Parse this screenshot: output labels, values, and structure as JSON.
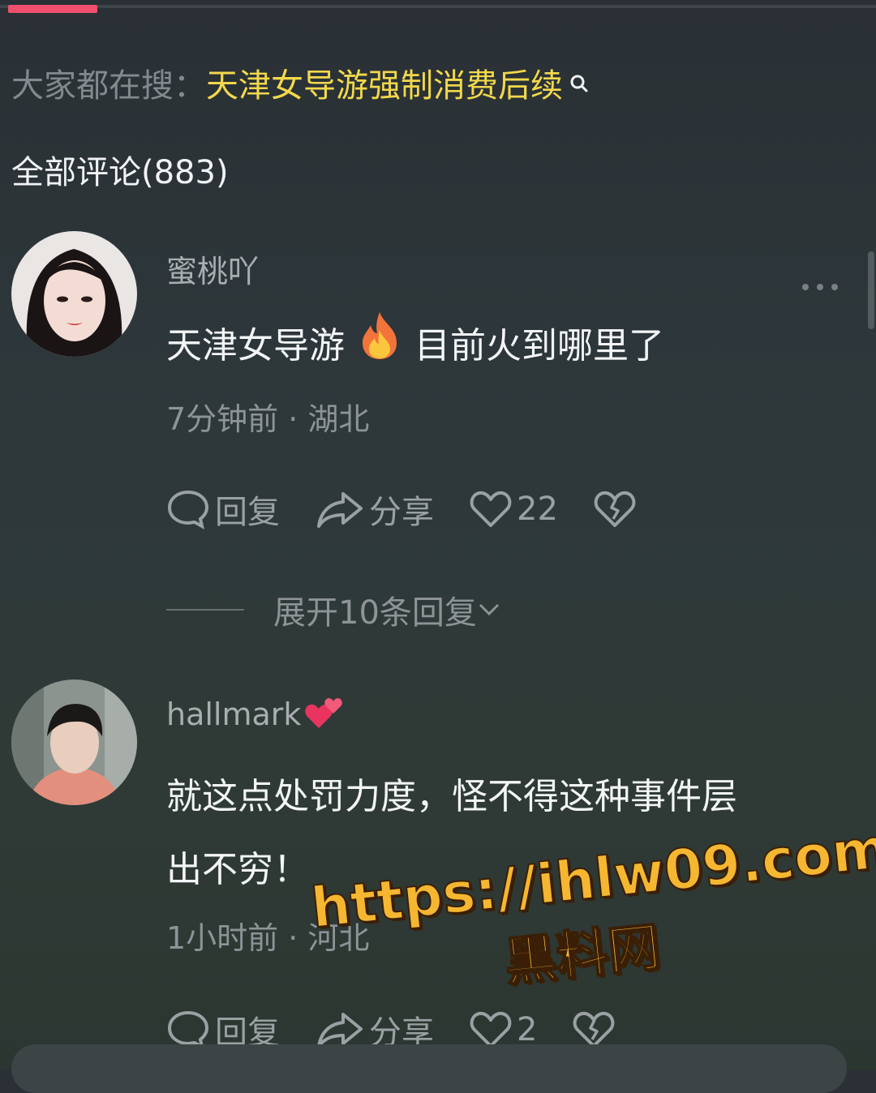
{
  "search": {
    "prefix": "大家都在搜：",
    "term": "天津女导游强制消费后续"
  },
  "comments_header": {
    "title": "全部评论(883)"
  },
  "comments": [
    {
      "username": "蜜桃吖",
      "text_before_emoji": "天津女导游",
      "emoji": "fire-emoji",
      "text_after_emoji": "目前火到哪里了",
      "meta": "7分钟前 · 湖北",
      "reply_label": "回复",
      "share_label": "分享",
      "like_count": "22",
      "expand_label": "展开10条回复"
    },
    {
      "username": "hallmark",
      "username_emoji": "two-hearts-emoji",
      "text_line1": "就这点处罚力度，怪不得这种事件层",
      "text_line2": "出不穷！",
      "meta": "1小时前 · 河北",
      "reply_label": "回复",
      "share_label": "分享",
      "like_count": "2"
    }
  ],
  "watermark": {
    "url": "https://ihlw09.com",
    "name": "黑料网"
  },
  "colors": {
    "accent": "#f0506e",
    "search_term": "#f2d84c",
    "watermark": "#f5b731"
  }
}
